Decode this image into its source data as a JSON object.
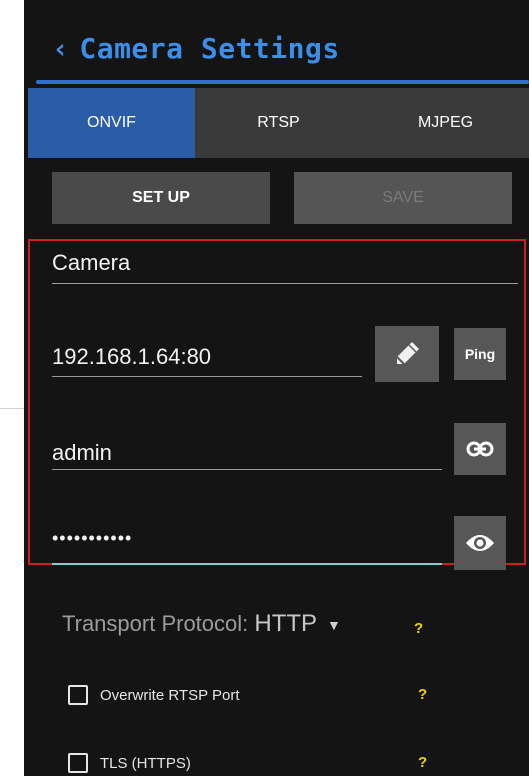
{
  "header": {
    "title": "Camera Settings",
    "back_glyph": "‹"
  },
  "tabs": [
    {
      "label": "ONVIF",
      "active": true
    },
    {
      "label": "RTSP",
      "active": false
    },
    {
      "label": "MJPEG",
      "active": false
    }
  ],
  "actions": {
    "setup_label": "SET UP",
    "save_label": "SAVE"
  },
  "form": {
    "name_value": "Camera",
    "address_value": "192.168.1.64:80",
    "ping_label": "Ping",
    "username_value": "admin",
    "password_value": "•••••••••••"
  },
  "transport": {
    "label": "Transport Protocol: ",
    "value": "HTTP",
    "help": "?"
  },
  "options": [
    {
      "label": "Overwrite RTSP Port",
      "checked": false,
      "help": "?"
    },
    {
      "label": "TLS (HTTPS)",
      "checked": false,
      "help": "?"
    }
  ],
  "colors": {
    "accent": "#3d8ee6",
    "active_tab": "#2b5ca8",
    "highlight_border": "#cc1f1f",
    "help": "#f2d000",
    "focus_underline": "#7fd1cf"
  },
  "icons": {
    "edit": "pencil-icon",
    "link": "link-icon",
    "reveal": "eye-icon",
    "dropdown": "caret-down-icon"
  }
}
